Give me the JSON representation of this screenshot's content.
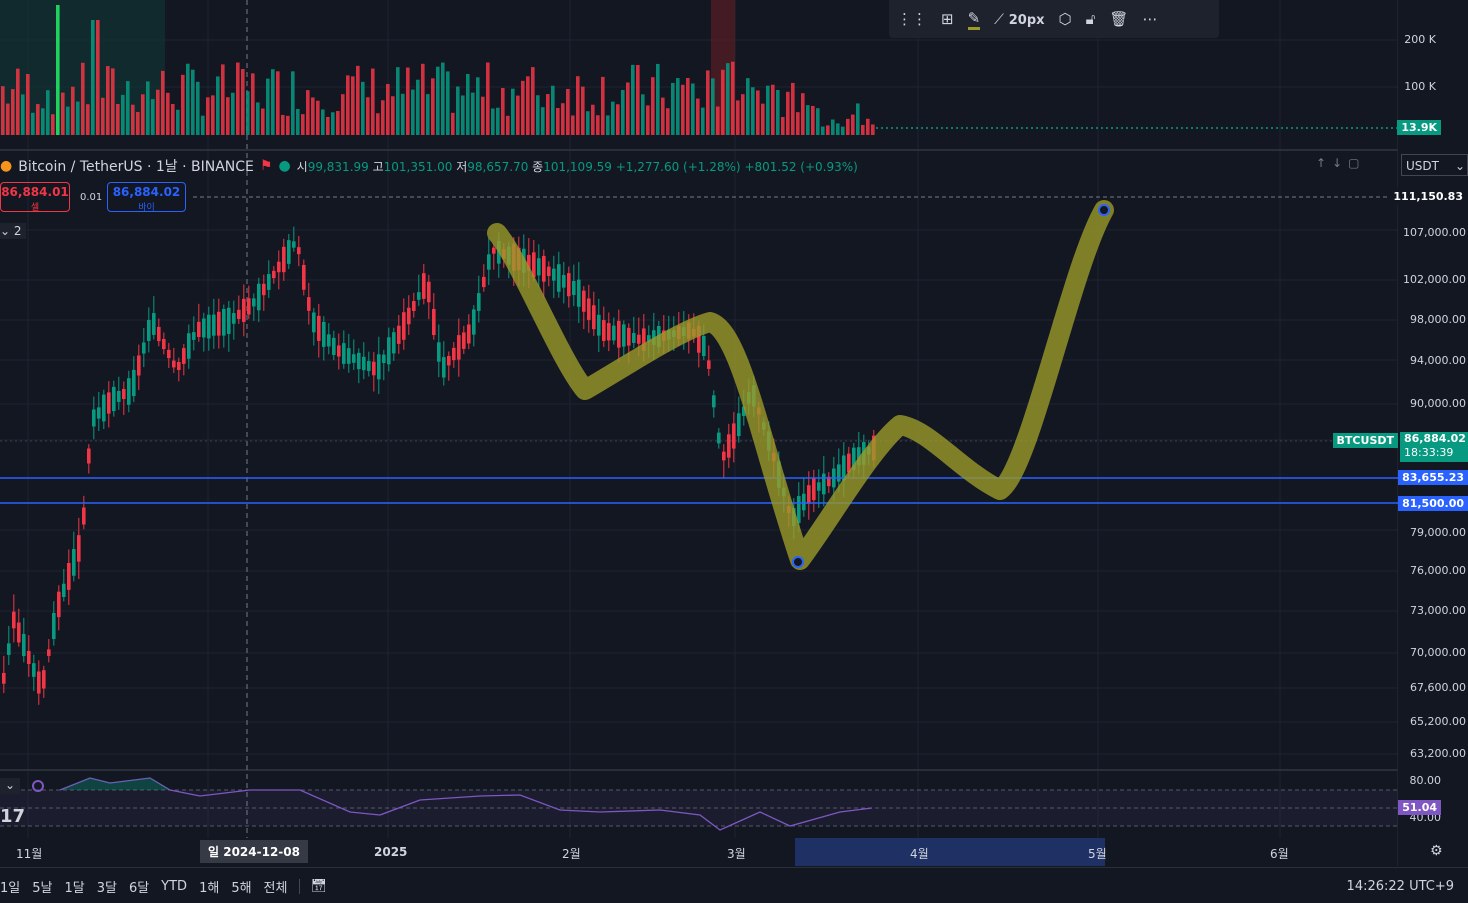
{
  "toolbar": {
    "drag_icon": "drag-handle-icon",
    "layout_icon": "layout-icon",
    "pencil_icon": "pencil-icon",
    "line_width_label": "20px",
    "settings_icon": "settings-icon",
    "lock_icon": "lock-icon",
    "delete_icon": "trash-icon",
    "more_icon": "more-icon"
  },
  "legend": {
    "symbol": "Bitcoin / TetherUS · 1날 · BINANCE",
    "open_label": "시",
    "open_value": "99,831.99",
    "high_label": "고",
    "high_value": "101,351.00",
    "low_label": "저",
    "low_value": "98,657.70",
    "close_label": "종",
    "close_value": "101,109.59",
    "change": "+1,277.60 (+1.28%)",
    "change2": "+801.52 (+0.93%)"
  },
  "trade": {
    "sell_price": "86,884.01",
    "sell_label": "셀",
    "spread": "0.01",
    "buy_price": "86,884.02",
    "buy_label": "바이",
    "collapse_count": "2"
  },
  "currency_select": "USDT",
  "volume_axis": [
    "200 K",
    "100 K"
  ],
  "volume_tag": "13.9K",
  "price_axis": [
    "107,000.00",
    "102,000.00",
    "98,000.00",
    "94,000.00",
    "90,000.00",
    "79,000.00",
    "76,000.00",
    "73,000.00",
    "70,000.00",
    "67,600.00",
    "65,200.00",
    "63,200.00"
  ],
  "price_tags": {
    "top": "111,150.83",
    "symbol": "BTCUSDT",
    "last": "86,884.02",
    "countdown": "18:33:39",
    "line1": "83,655.23",
    "line2": "81,500.00"
  },
  "rsi": {
    "axis_top": "80.00",
    "axis_bottom": "40.00",
    "value": "51.04"
  },
  "time_axis": {
    "labels": [
      "11월",
      "2025",
      "2월",
      "3월",
      "4월",
      "5월",
      "6월"
    ],
    "crosshair": "일 2024-12-08"
  },
  "bottom": {
    "ranges": [
      "1일",
      "5날",
      "1달",
      "3달",
      "6달",
      "YTD",
      "1해",
      "5해",
      "전체"
    ],
    "clock": "14:26:22 UTC+9"
  },
  "colors": {
    "up": "#089981",
    "down": "#f23645",
    "drawing": "#9b9a2a",
    "hline": "#2962ff",
    "rsi": "#7e57c2"
  },
  "chart_data": {
    "type": "candlestick",
    "x_range": [
      "2024-10-20",
      "2025-06-15"
    ],
    "y_range": [
      62000,
      113000
    ],
    "horizontal_lines": [
      83655.23,
      81500.0
    ],
    "drawing_path": [
      [
        "2025-01-20",
        107500
      ],
      [
        "2025-02-10",
        91500
      ],
      [
        "2025-03-01",
        98500
      ],
      [
        "2025-03-10",
        77000
      ],
      [
        "2025-03-20",
        87500
      ],
      [
        "2025-04-15",
        82000
      ],
      [
        "2025-05-01",
        111150
      ]
    ]
  }
}
